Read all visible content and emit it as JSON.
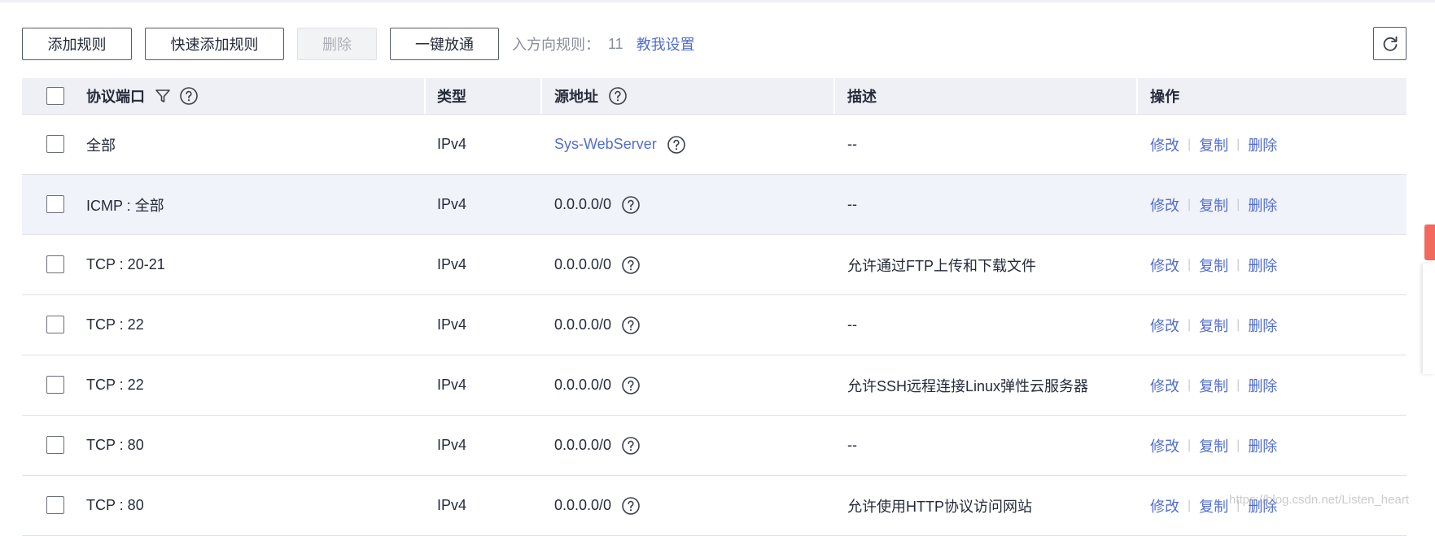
{
  "toolbar": {
    "add_rule": "添加规则",
    "quick_add_rule": "快速添加规则",
    "delete": "删除",
    "one_click_allow": "一键放通",
    "inbound_label": "入方向规则：",
    "inbound_count": "11",
    "help_link": "教我设置"
  },
  "table": {
    "headers": {
      "protocol_port": "协议端口",
      "type": "类型",
      "source": "源地址",
      "description": "描述",
      "actions": "操作"
    },
    "rows": [
      {
        "protocol": "全部",
        "type": "IPv4",
        "source": "Sys-WebServer",
        "desc": "--",
        "source_is_link": true
      },
      {
        "protocol": "ICMP : 全部",
        "type": "IPv4",
        "source": "0.0.0.0/0",
        "desc": "--"
      },
      {
        "protocol": "TCP : 20-21",
        "type": "IPv4",
        "source": "0.0.0.0/0",
        "desc": "允许通过FTP上传和下载文件"
      },
      {
        "protocol": "TCP : 22",
        "type": "IPv4",
        "source": "0.0.0.0/0",
        "desc": "--"
      },
      {
        "protocol": "TCP : 22",
        "type": "IPv4",
        "source": "0.0.0.0/0",
        "desc": "允许SSH远程连接Linux弹性云服务器"
      },
      {
        "protocol": "TCP : 80",
        "type": "IPv4",
        "source": "0.0.0.0/0",
        "desc": "--"
      },
      {
        "protocol": "TCP : 80",
        "type": "IPv4",
        "source": "0.0.0.0/0",
        "desc": "允许使用HTTP协议访问网站"
      }
    ],
    "actions": {
      "modify": "修改",
      "copy": "复制",
      "delete": "删除"
    }
  },
  "watermark": "https://blog.csdn.net/Listen_heart",
  "colors": {
    "link": "#526ecc",
    "header_bg": "#eef0f5",
    "hover_row": "#f1f3fb",
    "side_tab": "#f26a5d"
  },
  "icons": [
    "filter-icon",
    "help-icon",
    "refresh-icon"
  ]
}
